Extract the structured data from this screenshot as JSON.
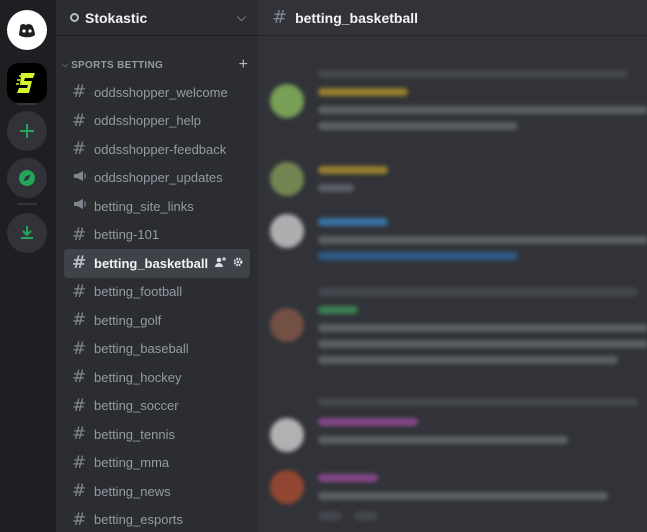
{
  "server": {
    "name": "Stokastic"
  },
  "category": {
    "label": "SPORTS BETTING"
  },
  "channels": [
    {
      "name": "oddsshopper_welcome",
      "icon": "hash-icon"
    },
    {
      "name": "oddsshopper_help",
      "icon": "hash-icon"
    },
    {
      "name": "oddsshopper-feedback",
      "icon": "hash-icon"
    },
    {
      "name": "oddsshopper_updates",
      "icon": "announcement-icon"
    },
    {
      "name": "betting_site_links",
      "icon": "announcement-icon"
    },
    {
      "name": "betting-101",
      "icon": "hash-icon"
    },
    {
      "name": "betting_basketball",
      "icon": "hash-icon",
      "active": true
    },
    {
      "name": "betting_football",
      "icon": "hash-icon"
    },
    {
      "name": "betting_golf",
      "icon": "hash-icon"
    },
    {
      "name": "betting_baseball",
      "icon": "hash-icon"
    },
    {
      "name": "betting_hockey",
      "icon": "hash-icon"
    },
    {
      "name": "betting_soccer",
      "icon": "hash-icon"
    },
    {
      "name": "betting_tennis",
      "icon": "hash-icon"
    },
    {
      "name": "betting_mma",
      "icon": "hash-icon"
    },
    {
      "name": "betting_news",
      "icon": "hash-icon"
    },
    {
      "name": "betting_esports",
      "icon": "hash-icon"
    }
  ],
  "chat": {
    "channel_title": "betting_basketball"
  },
  "colors": {
    "accent": "#5865f2",
    "green": "#23a55a",
    "active_bg": "#404249"
  }
}
